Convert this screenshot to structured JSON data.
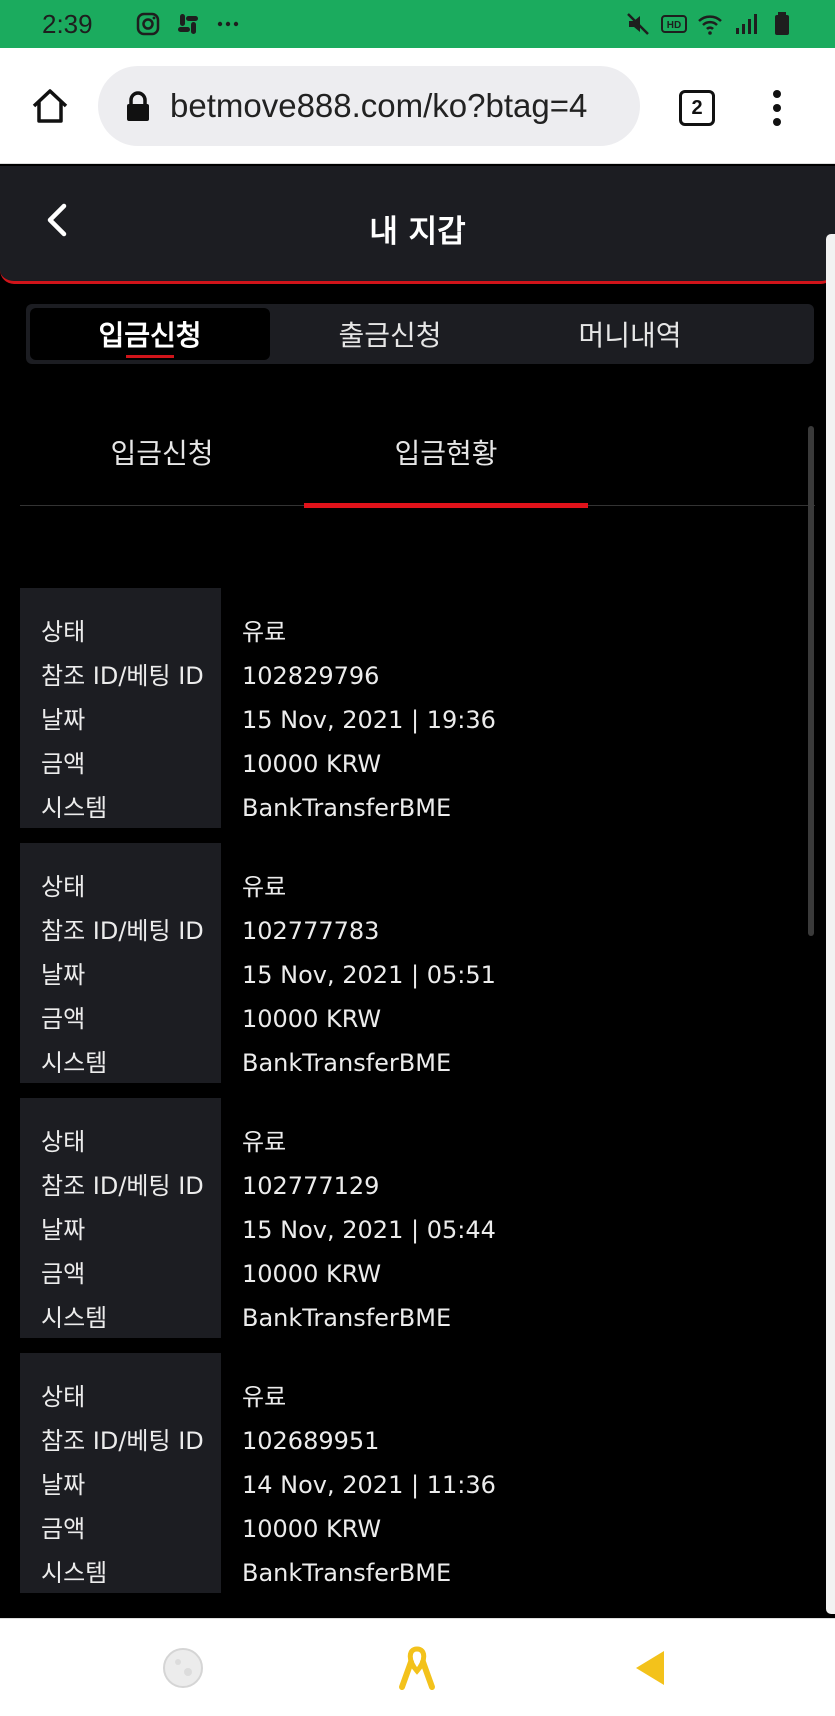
{
  "status_bar": {
    "time": "2:39",
    "left_icons": [
      "instagram-icon",
      "slack-icon",
      "more-icon"
    ],
    "right_icons": [
      "mute-icon",
      "hd-icon",
      "wifi-icon",
      "signal-icon",
      "battery-icon"
    ]
  },
  "browser": {
    "url": "betmove888.com/ko?btag=4",
    "tab_count": "2"
  },
  "header": {
    "title": "내 지갑"
  },
  "main_tabs": [
    {
      "label": "입금신청",
      "active": true
    },
    {
      "label": "출금신청",
      "active": false
    },
    {
      "label": "머니내역",
      "active": false
    }
  ],
  "sub_tabs": [
    {
      "label": "입금신청",
      "active": false
    },
    {
      "label": "입금현황",
      "active": true
    }
  ],
  "field_labels": {
    "status": "상태",
    "ref_id": "참조 ID/베팅 ID",
    "date": "날짜",
    "amount": "금액",
    "system": "시스템"
  },
  "records": [
    {
      "status": "유료",
      "ref_id": "102829796",
      "date": "15 Nov, 2021 | 19:36",
      "amount": "10000 KRW",
      "system": "BankTransferBME"
    },
    {
      "status": "유료",
      "ref_id": "102777783",
      "date": "15 Nov, 2021 | 05:51",
      "amount": "10000 KRW",
      "system": "BankTransferBME"
    },
    {
      "status": "유료",
      "ref_id": "102777129",
      "date": "15 Nov, 2021 | 05:44",
      "amount": "10000 KRW",
      "system": "BankTransferBME"
    },
    {
      "status": "유료",
      "ref_id": "102689951",
      "date": "14 Nov, 2021 | 11:36",
      "amount": "10000 KRW",
      "system": "BankTransferBME"
    }
  ],
  "bottom_nav": [
    "moon-icon",
    "ribbon-icon",
    "back-triangle-icon"
  ],
  "colors": {
    "status_bar": "#1bab5e",
    "accent_red": "#d0141a",
    "panel": "#1c1d22",
    "ribbon": "#f3c21b"
  }
}
